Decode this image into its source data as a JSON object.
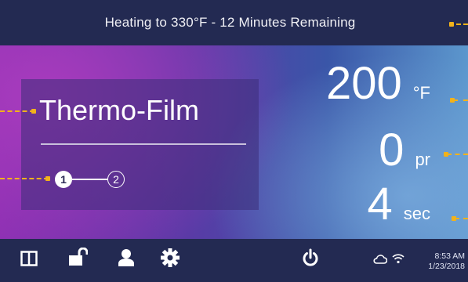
{
  "status": {
    "message": "Heating to 330°F - 12 Minutes Remaining"
  },
  "film": {
    "name": "Thermo-Film",
    "steps": [
      "1",
      "2"
    ],
    "active_step": 1
  },
  "readouts": {
    "temperature": {
      "value": "200",
      "unit": "°F"
    },
    "pressure": {
      "value": "0",
      "unit": "pr"
    },
    "time": {
      "value": "4",
      "unit": "sec"
    }
  },
  "nav": {
    "icons": [
      "layout-icon",
      "unlock-icon",
      "user-icon",
      "settings-gear-icon",
      "power-icon",
      "cloud-icon",
      "wifi-icon"
    ]
  },
  "clock": {
    "time": "8:53 AM",
    "date": "1/23/2018"
  },
  "colors": {
    "bar_background": "#232a52",
    "callout_leader": "#f2b21b",
    "gradient_left": "#8a2fb2",
    "gradient_right": "#5c97cd"
  }
}
